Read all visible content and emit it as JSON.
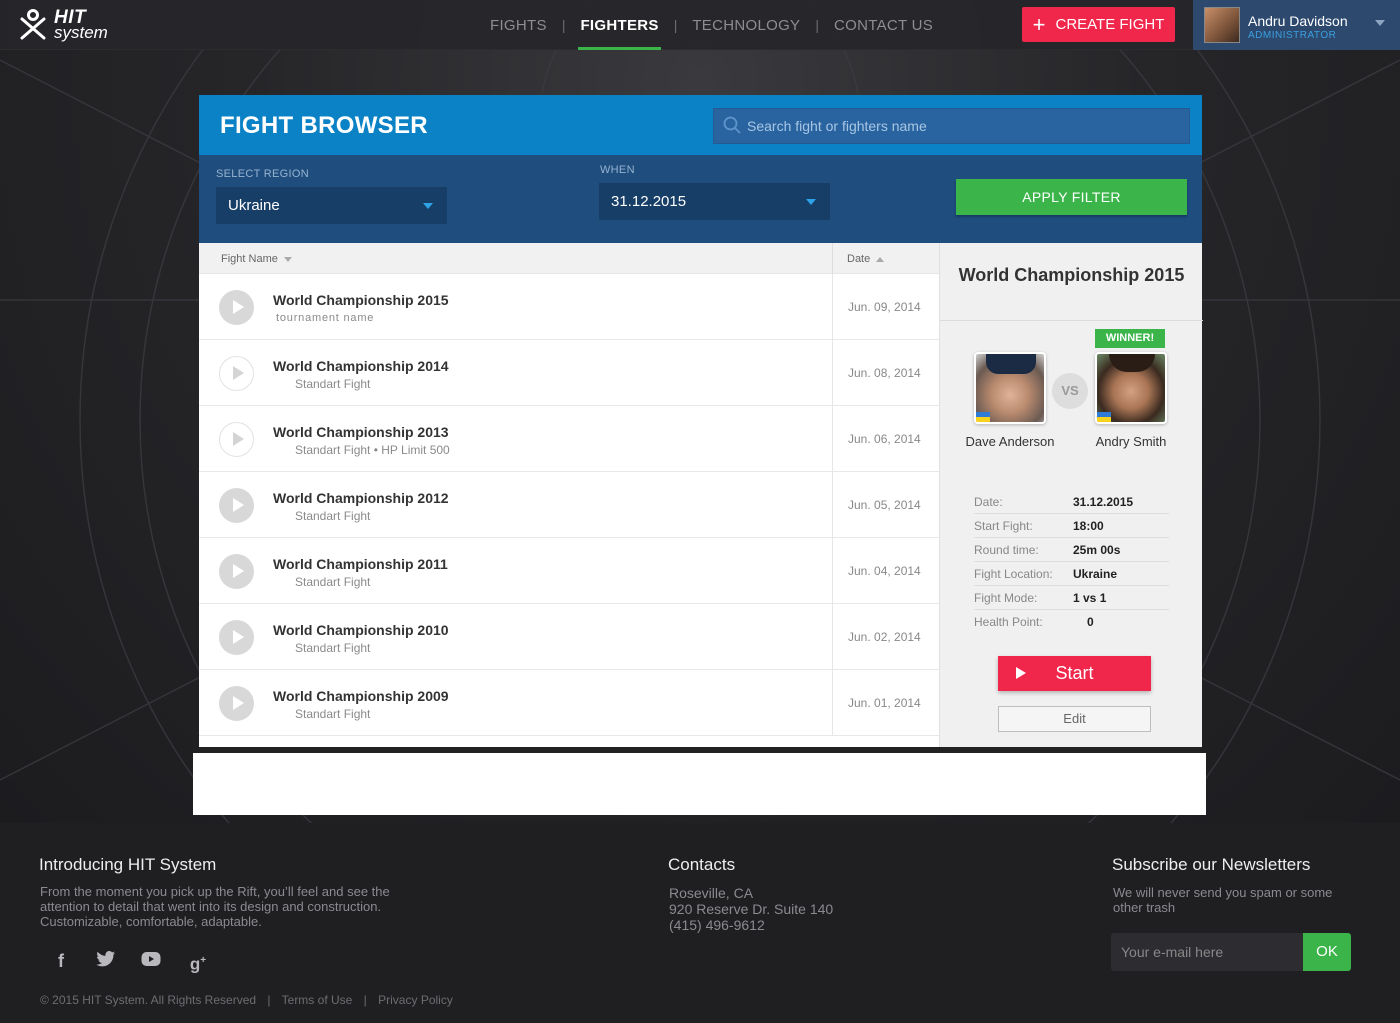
{
  "brand": {
    "line1": "HIT",
    "line2": "system"
  },
  "nav": {
    "items": [
      {
        "label": "FIGHTS",
        "active": false
      },
      {
        "label": "FIGHTERS",
        "active": true
      },
      {
        "label": "TECHNOLOGY",
        "active": false
      },
      {
        "label": "CONTACT US",
        "active": false
      }
    ],
    "separator": "|"
  },
  "header": {
    "create_button": "CREATE FIGHT",
    "create_icon": "+"
  },
  "user": {
    "name": "Andru Davidson",
    "role": "ADMINISTRATOR"
  },
  "panel": {
    "title": "FIGHT BROWSER",
    "search_placeholder": "Search fight or fighters name",
    "region_label": "SELECT REGION",
    "region_value": "Ukraine",
    "when_label": "WHEN",
    "when_value": "31.12.2015",
    "apply_label": "APPLY FILTER"
  },
  "list": {
    "col_name": "Fight Name",
    "col_date": "Date",
    "rows": [
      {
        "name": "World Championship 2015",
        "sub": "tournament name",
        "date": "Jun. 09, 2014"
      },
      {
        "name": "World Championship 2014",
        "sub": "Standart Fight",
        "date": "Jun. 08, 2014"
      },
      {
        "name": "World Championship 2013",
        "sub": "Standart Fight • HP Limit 500",
        "date": "Jun. 06, 2014"
      },
      {
        "name": "World Championship 2012",
        "sub": "Standart Fight",
        "date": "Jun. 05, 2014"
      },
      {
        "name": "World Championship 2011",
        "sub": "Standart Fight",
        "date": "Jun. 04, 2014"
      },
      {
        "name": "World Championship 2010",
        "sub": "Standart Fight",
        "date": "Jun. 02, 2014"
      },
      {
        "name": "World Championship 2009",
        "sub": "Standart Fight",
        "date": "Jun. 01, 2014"
      }
    ]
  },
  "detail": {
    "title": "World Championship 2015",
    "winner_badge": "WINNER!",
    "vs": "VS",
    "fighter_a": "Dave Anderson",
    "fighter_b": "Andry Smith",
    "info": [
      {
        "key": "Date:",
        "value": "31.12.2015"
      },
      {
        "key": "Start Fight:",
        "value": "18:00"
      },
      {
        "key": "Round time:",
        "value": "25m 00s"
      },
      {
        "key": "Fight Location:",
        "value": "Ukraine"
      },
      {
        "key": "Fight Mode:",
        "value": "1 vs 1"
      },
      {
        "key": "Health Point:",
        "value": "0"
      }
    ],
    "start_label": "Start",
    "edit_label": "Edit"
  },
  "footer": {
    "intro_title": "Introducing HIT System",
    "intro_text": "From the moment you pick up the Rift, you’ll feel and see the attention to detail that went into its design and construction. Customizable, comfortable, adaptable.",
    "contacts_title": "Contacts",
    "contacts_lines": [
      "Roseville, CA",
      "920 Reserve Dr. Suite 140",
      "(415) 496-9612"
    ],
    "newsletter_title": "Subscribe our Newsletters",
    "newsletter_text": "We will never send you spam or some other trash",
    "email_placeholder": "Your e-mail here",
    "ok_label": "OK",
    "social": [
      "facebook-icon",
      "twitter-icon",
      "youtube-icon",
      "google-plus-icon"
    ],
    "copyright": "© 2015 HIT System. All Rights Reserved",
    "terms": "Terms of Use",
    "privacy": "Privacy Policy",
    "legal_sep": "|"
  },
  "colors": {
    "accent_red": "#f0264b",
    "accent_green": "#3bb54a",
    "panel_blue": "#0b82c6",
    "filter_blue": "#1e4d7e"
  }
}
